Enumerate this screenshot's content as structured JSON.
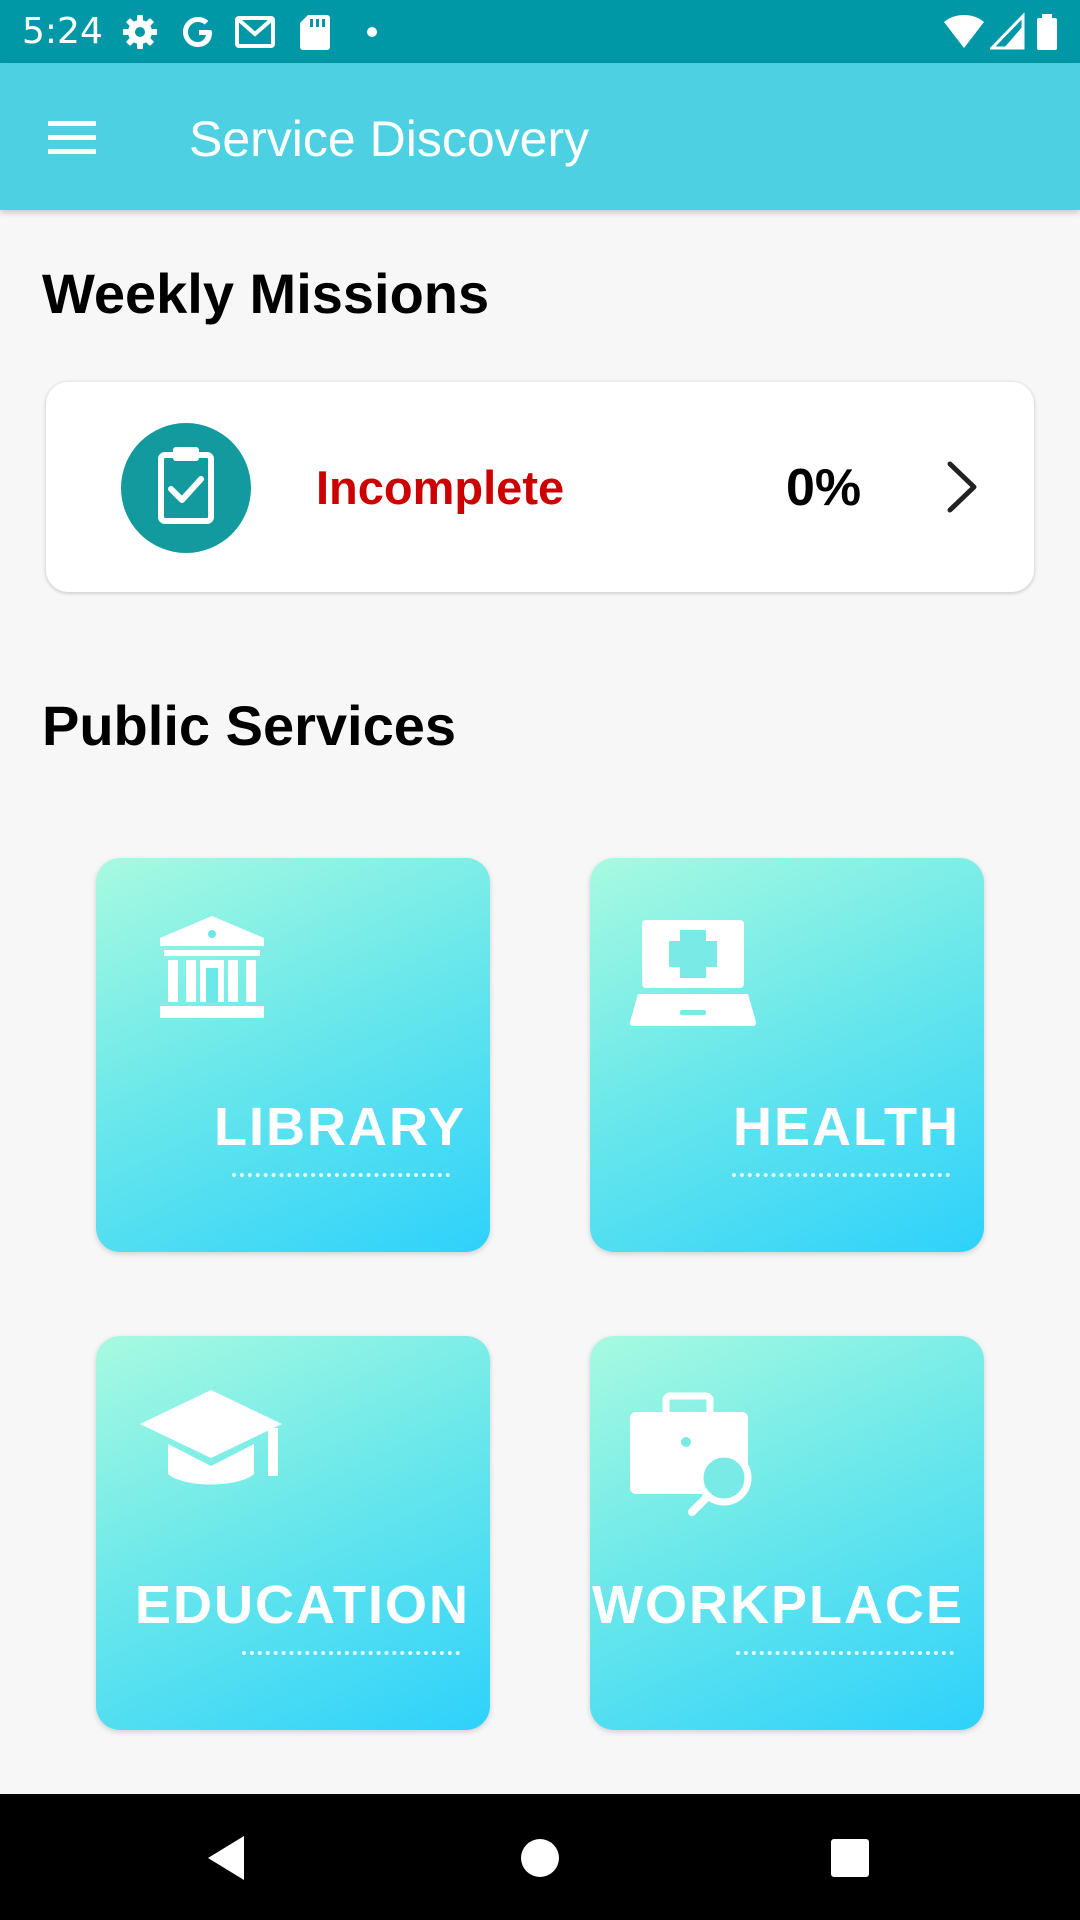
{
  "status_bar": {
    "time": "5:24",
    "icons": [
      "settings-icon",
      "google-icon",
      "gmail-icon",
      "sd-card-icon",
      "dot-icon",
      "wifi-icon",
      "signal-icon",
      "battery-icon"
    ]
  },
  "app_bar": {
    "title": "Service Discovery",
    "menu_icon": "hamburger-menu-icon"
  },
  "weekly_missions": {
    "heading": "Weekly Missions",
    "status": "Incomplete",
    "status_color": "#cc0000",
    "percent": "0%",
    "progress": 0,
    "icon": "clipboard-check-icon",
    "icon_bg": "#139a9e"
  },
  "public_services": {
    "heading": "Public Services",
    "tiles": [
      {
        "label": "LIBRARY",
        "icon": "library-building-icon"
      },
      {
        "label": "HEALTH",
        "icon": "medical-laptop-icon"
      },
      {
        "label": "EDUCATION",
        "icon": "graduation-cap-icon"
      },
      {
        "label": "WORKPLACE",
        "icon": "briefcase-search-icon"
      }
    ]
  },
  "nav_bar": {
    "buttons": [
      "back-icon",
      "home-icon",
      "recents-icon"
    ]
  },
  "colors": {
    "status_bar": "#0097a7",
    "app_bar": "#4dd0e1",
    "tile_gradient_start": "#a8fae0",
    "tile_gradient_end": "#2ed1fb"
  }
}
